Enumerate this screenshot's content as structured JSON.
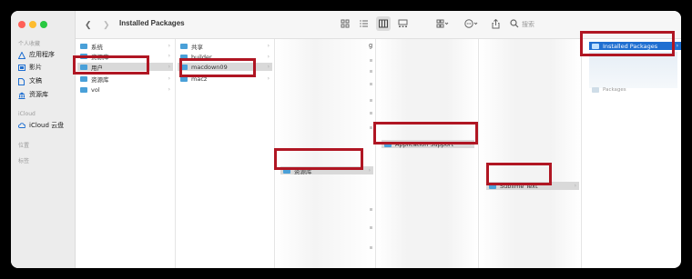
{
  "sidebar": {
    "favorites_header": "个人收藏",
    "favorites": [
      {
        "label": "应用程序"
      },
      {
        "label": "影片"
      },
      {
        "label": "文稿"
      },
      {
        "label": "资源库"
      }
    ],
    "icloud_header": "iCloud",
    "icloud_drive": "iCloud 云盘",
    "locations_header": "位置",
    "tags_header": "标签"
  },
  "toolbar": {
    "title": "Installed Packages",
    "search_placeholder": "搜索"
  },
  "columns": {
    "col1": [
      {
        "label": "系统"
      },
      {
        "label": "资源库"
      },
      {
        "label": "用户"
      },
      {
        "label": "资源库"
      },
      {
        "label": "vol"
      }
    ],
    "col2": [
      {
        "label": "共享"
      },
      {
        "label": "builder"
      },
      {
        "label": "macdown09"
      },
      {
        "label": "macz"
      }
    ],
    "col3_item": "资源库",
    "col4_item": "Application Support",
    "col5_item": "Sublime Text",
    "col6_items": [
      {
        "label": "Installed Packages"
      },
      {
        "label": "Packages"
      }
    ],
    "partial_text": "g"
  },
  "colors": {
    "highlight_box": "#b01623",
    "selection_blue": "#1f6fd1",
    "folder": "#4aa0d8"
  }
}
